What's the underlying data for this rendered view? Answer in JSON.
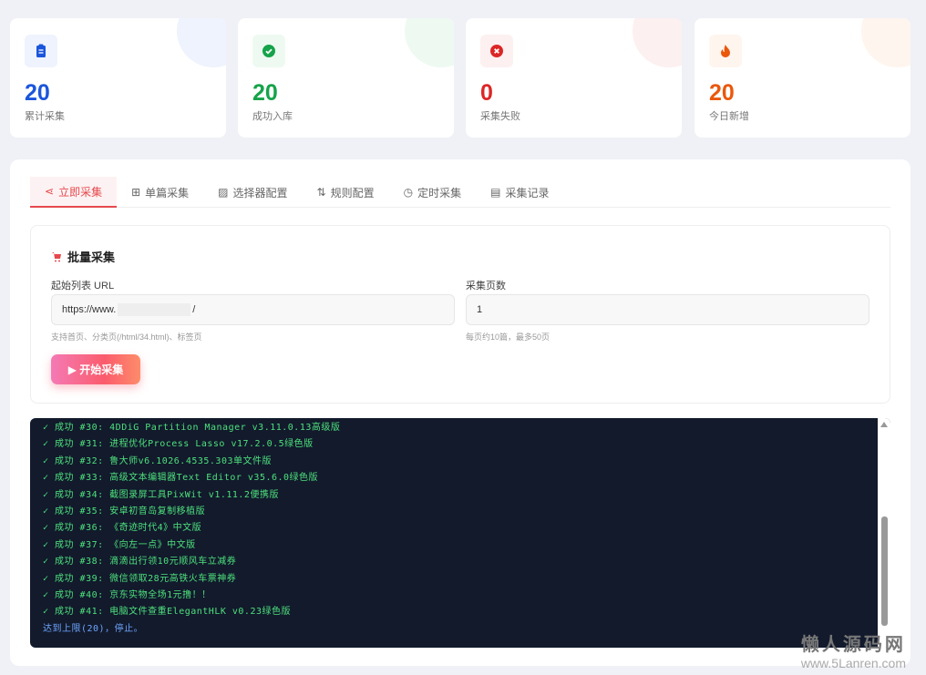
{
  "stats": [
    {
      "value": "20",
      "label": "累计采集",
      "icon": "clipboard-icon",
      "color": "#1a56db",
      "bg": "#eef3fd"
    },
    {
      "value": "20",
      "label": "成功入库",
      "icon": "check-circle-icon",
      "color": "#16a34a",
      "bg": "#eefaf1"
    },
    {
      "value": "0",
      "label": "采集失败",
      "icon": "x-circle-icon",
      "color": "#dc2626",
      "bg": "#fdf0f0"
    },
    {
      "value": "20",
      "label": "今日新增",
      "icon": "fire-icon",
      "color": "#ea580c",
      "bg": "#fef5ee"
    }
  ],
  "tabs": [
    {
      "label": "立即采集",
      "icon": "share-icon"
    },
    {
      "label": "单篇采集",
      "icon": "plus-square-icon"
    },
    {
      "label": "选择器配置",
      "icon": "image-icon"
    },
    {
      "label": "规则配置",
      "icon": "sort-icon"
    },
    {
      "label": "定时采集",
      "icon": "clock-icon"
    },
    {
      "label": "采集记录",
      "icon": "file-icon"
    }
  ],
  "batch": {
    "title": "批量采集",
    "url_label": "起始列表 URL",
    "url_value": "https://www.",
    "url_suffix": "/",
    "url_hint": "支持首页、分类页(/html/34.html)、标签页",
    "pages_label": "采集页数",
    "pages_value": "1",
    "pages_hint": "每页约10篇，最多50页",
    "start_button": "▶ 开始采集"
  },
  "log": [
    "✓ 成功 #30: 4DDiG Partition Manager v3.11.0.13高级版",
    "✓ 成功 #31: 进程优化Process Lasso v17.2.0.5绿色版",
    "✓ 成功 #32: 鲁大师v6.1026.4535.303单文件版",
    "✓ 成功 #33: 高级文本编辑器Text Editor v35.6.0绿色版",
    "✓ 成功 #34: 截图录屏工具PixWit v1.11.2便携版",
    "✓ 成功 #35: 安卓初音岛复制移植版",
    "✓ 成功 #36: 《奇迹时代4》中文版",
    "✓ 成功 #37: 《向左一点》中文版",
    "✓ 成功 #38: 滴滴出行领10元顺风车立减券",
    "✓ 成功 #39: 微信领取28元高铁火车票神券",
    "✓ 成功 #40: 京东实物全场1元撸！！",
    "✓ 成功 #41: 电脑文件查重ElegantHLK v0.23绿色版"
  ],
  "log_done": "达到上限(20)，停止。",
  "watermark": {
    "line1": "懒人源码网",
    "line2": "www.5Lanren.com"
  }
}
